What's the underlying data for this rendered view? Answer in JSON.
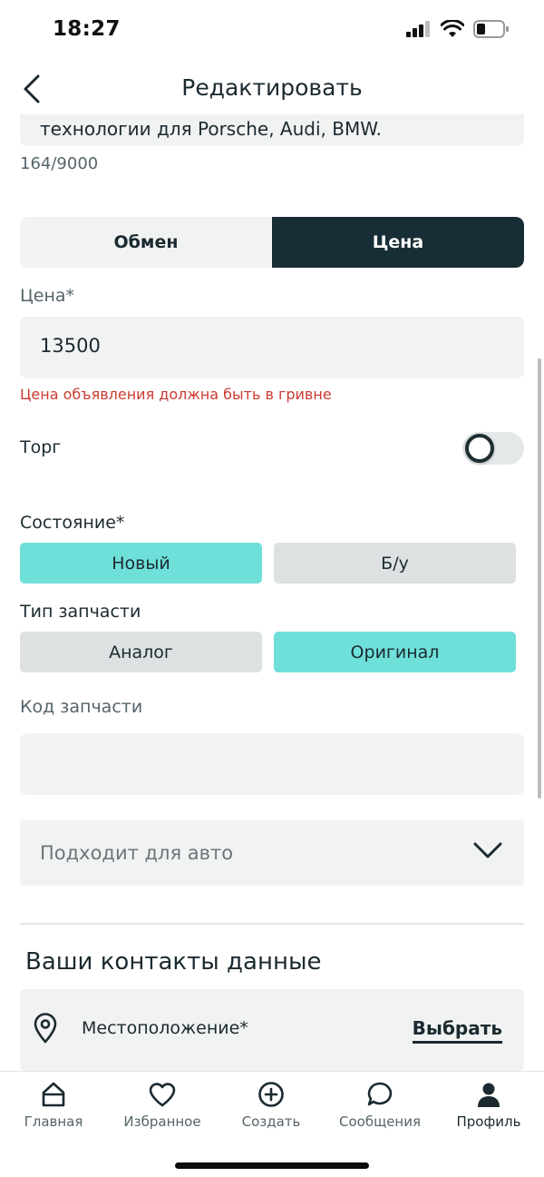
{
  "status_bar": {
    "time": "18:27"
  },
  "header": {
    "title": "Редактировать"
  },
  "description": {
    "visible_text": "технологии для Porsche, Audi, BMW.",
    "counter": "164/9000"
  },
  "deal_type": {
    "options": [
      "Обмен",
      "Цена"
    ],
    "selected": "Цена"
  },
  "price": {
    "label": "Цена*",
    "value": "13500",
    "error": "Цена объявления должна быть в гривне"
  },
  "bargain": {
    "label": "Торг",
    "enabled": false
  },
  "condition": {
    "label": "Состояние*",
    "options": [
      "Новый",
      "Б/у"
    ],
    "selected": "Новый"
  },
  "part_type": {
    "label": "Тип запчасти",
    "options": [
      "Аналог",
      "Оригинал"
    ],
    "selected": "Оригинал"
  },
  "part_code": {
    "label": "Код запчасти",
    "value": ""
  },
  "fits_car": {
    "placeholder": "Подходит для авто"
  },
  "contacts": {
    "title": "Ваши контакты данные",
    "location_label": "Местоположение*",
    "choose_label": "Выбрать"
  },
  "colors": {
    "accent": "#6ee0d9",
    "dark": "#172e36",
    "error": "#cc3a31",
    "field_bg": "#f1f2f2"
  },
  "bottom_nav": {
    "items": [
      {
        "label": "Главная",
        "icon": "home-icon"
      },
      {
        "label": "Избранное",
        "icon": "heart-icon"
      },
      {
        "label": "Создать",
        "icon": "plus-circle-icon"
      },
      {
        "label": "Сообщения",
        "icon": "chat-icon"
      },
      {
        "label": "Профиль",
        "icon": "user-icon"
      }
    ],
    "active": "Профиль"
  }
}
